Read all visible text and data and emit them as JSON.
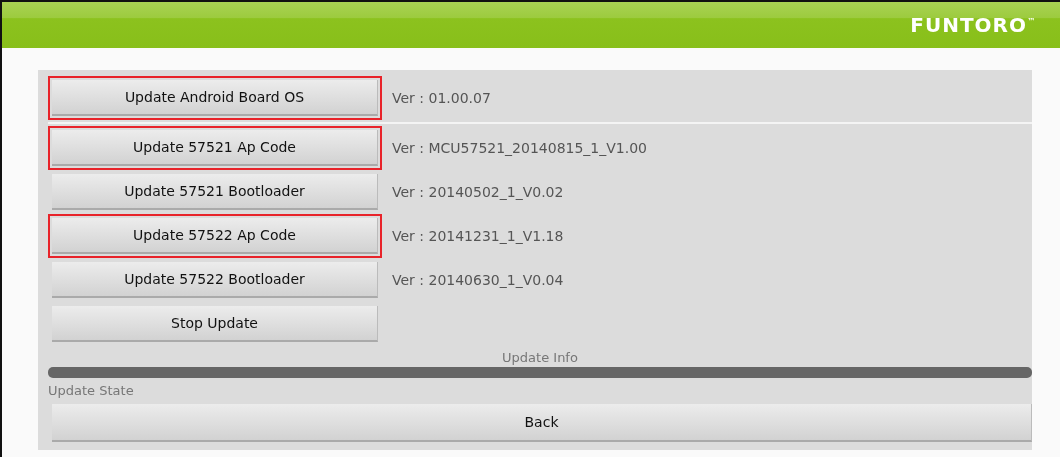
{
  "header": {
    "logo": "FUNTORO",
    "trademark": "™"
  },
  "top_row": {
    "button": "Update Android Board OS",
    "version": "Ver : 01.00.07",
    "highlighted": true
  },
  "rows": [
    {
      "button": "Update 57521 Ap Code",
      "version": "Ver : MCU57521_20140815_1_V1.00",
      "highlighted": true
    },
    {
      "button": "Update 57521 Bootloader",
      "version": "Ver : 20140502_1_V0.02",
      "highlighted": false
    },
    {
      "button": "Update 57522 Ap Code",
      "version": "Ver : 20141231_1_V1.18",
      "highlighted": true
    },
    {
      "button": "Update 57522 Bootloader",
      "version": "Ver : 20140630_1_V0.04",
      "highlighted": false
    },
    {
      "button": "Stop Update",
      "highlighted": false
    }
  ],
  "update_info": {
    "label": "Update Info"
  },
  "update_state": "Update State",
  "back_button": "Back"
}
